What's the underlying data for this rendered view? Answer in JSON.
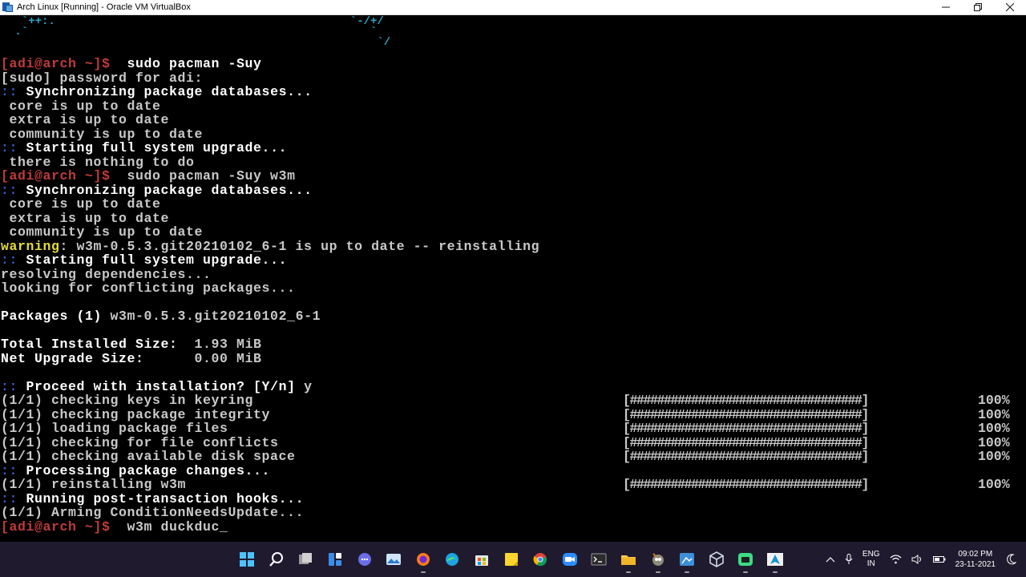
{
  "window": {
    "title": "Arch Linux [Running] - Oracle VM VirtualBox",
    "controls": {
      "minimize_icon": "minimize-icon",
      "restore_icon": "restore-icon",
      "close_icon": "close-icon"
    }
  },
  "terminal": {
    "ascii_art": {
      "left": "  `++:.\n .`",
      "right": "  `-/+/\n     `\n      `/"
    },
    "lines": [
      [
        {
          "t": "[adi@arch ~]$",
          "c": "p"
        },
        {
          "t": "  sudo pacman -Suy",
          "c": "w"
        }
      ],
      [
        {
          "t": "[sudo] password for adi:",
          "c": "g"
        }
      ],
      [
        {
          "t": "::",
          "c": "b"
        },
        {
          "t": " Synchronizing package databases...",
          "c": "w"
        }
      ],
      [
        {
          "t": " core is up to date",
          "c": "g"
        }
      ],
      [
        {
          "t": " extra is up to date",
          "c": "g"
        }
      ],
      [
        {
          "t": " community is up to date",
          "c": "g"
        }
      ],
      [
        {
          "t": "::",
          "c": "b"
        },
        {
          "t": " Starting full system upgrade...",
          "c": "w"
        }
      ],
      [
        {
          "t": " there is nothing to do",
          "c": "g"
        }
      ],
      [
        {
          "t": "[adi@arch ~]$",
          "c": "p"
        },
        {
          "t": "  sudo pacman -Suy w3m",
          "c": "g"
        }
      ],
      [
        {
          "t": "::",
          "c": "b"
        },
        {
          "t": " Synchronizing package databases...",
          "c": "w"
        }
      ],
      [
        {
          "t": " core is up to date",
          "c": "g"
        }
      ],
      [
        {
          "t": " extra is up to date",
          "c": "g"
        }
      ],
      [
        {
          "t": " community is up to date",
          "c": "g"
        }
      ],
      [
        {
          "t": "warning",
          "c": "y"
        },
        {
          "t": ": w3m-0.5.3.git20210102_6-1 is up to date -- reinstalling",
          "c": "g"
        }
      ],
      [
        {
          "t": "::",
          "c": "b"
        },
        {
          "t": " Starting full system upgrade...",
          "c": "w"
        }
      ],
      [
        {
          "t": "resolving dependencies...",
          "c": "g"
        }
      ],
      [
        {
          "t": "looking for conflicting packages...",
          "c": "g"
        }
      ],
      [
        {
          "t": "",
          "c": "g"
        }
      ],
      [
        {
          "t": "Packages (1) ",
          "c": "w"
        },
        {
          "t": "w3m-0.5.3.git20210102_6-1",
          "c": "g"
        }
      ],
      [
        {
          "t": "",
          "c": "g"
        }
      ],
      [
        {
          "t": "Total Installed Size: ",
          "c": "w"
        },
        {
          "t": " 1.93 MiB",
          "c": "g"
        }
      ],
      [
        {
          "t": "Net Upgrade Size: ",
          "c": "w"
        },
        {
          "t": "     0.00 MiB",
          "c": "g"
        }
      ],
      [
        {
          "t": "",
          "c": "g"
        }
      ],
      [
        {
          "t": "::",
          "c": "b"
        },
        {
          "t": " Proceed with installation? [Y/n]",
          "c": "w"
        },
        {
          "t": " y",
          "c": "g"
        }
      ],
      [
        {
          "t": "(1/1) checking keys in keyring",
          "c": "g"
        }
      ],
      [
        {
          "t": "(1/1) checking package integrity",
          "c": "g"
        }
      ],
      [
        {
          "t": "(1/1) loading package files",
          "c": "g"
        }
      ],
      [
        {
          "t": "(1/1) checking for file conflicts",
          "c": "g"
        }
      ],
      [
        {
          "t": "(1/1) checking available disk space",
          "c": "g"
        }
      ],
      [
        {
          "t": "::",
          "c": "b"
        },
        {
          "t": " Processing package changes...",
          "c": "w"
        }
      ],
      [
        {
          "t": "(1/1) reinstalling w3m",
          "c": "g"
        }
      ],
      [
        {
          "t": "::",
          "c": "b"
        },
        {
          "t": " Running post-transaction hooks...",
          "c": "w"
        }
      ],
      [
        {
          "t": "(1/1) Arming ConditionNeedsUpdate...",
          "c": "g"
        }
      ],
      [
        {
          "t": "[adi@arch ~]$",
          "c": "p"
        },
        {
          "t": "  w3m duckduc_",
          "c": "g"
        }
      ]
    ],
    "progress_bars": [
      {
        "line": 24,
        "bar": "[##################################]",
        "percent": "100%",
        "progress": 1.0
      },
      {
        "line": 25,
        "bar": "[##################################]",
        "percent": "100%",
        "progress": 1.0
      },
      {
        "line": 26,
        "bar": "[##################################]",
        "percent": "100%",
        "progress": 1.0
      },
      {
        "line": 27,
        "bar": "[##################################]",
        "percent": "100%",
        "progress": 1.0
      },
      {
        "line": 28,
        "bar": "[##################################]",
        "percent": "100%",
        "progress": 1.0
      },
      {
        "line": 30,
        "bar": "[##################################]",
        "percent": "100%",
        "progress": 1.0
      }
    ]
  },
  "taskbar": {
    "apps": [
      {
        "name": "start-button",
        "icon": "windows-icon"
      },
      {
        "name": "search-button",
        "icon": "search-icon"
      },
      {
        "name": "task-view-button",
        "icon": "task-view-icon"
      },
      {
        "name": "widgets-button",
        "icon": "widgets-icon"
      },
      {
        "name": "chat-button",
        "icon": "chat-icon"
      },
      {
        "name": "photos-app",
        "icon": "photos-icon"
      },
      {
        "name": "firefox-app",
        "icon": "firefox-icon",
        "running": true
      },
      {
        "name": "edge-app",
        "icon": "edge-icon"
      },
      {
        "name": "store-app",
        "icon": "store-icon"
      },
      {
        "name": "sticky-notes-app",
        "icon": "sticky-notes-icon"
      },
      {
        "name": "chrome-app",
        "icon": "chrome-icon"
      },
      {
        "name": "zoom-app",
        "icon": "zoom-icon"
      },
      {
        "name": "terminal-app",
        "icon": "terminal-icon"
      },
      {
        "name": "file-explorer-app",
        "icon": "folder-icon",
        "running": true
      },
      {
        "name": "gimp-app",
        "icon": "gimp-icon",
        "running": true
      },
      {
        "name": "paint-app",
        "icon": "paint-icon",
        "running": true
      },
      {
        "name": "virtualbox-app",
        "icon": "virtualbox-icon"
      },
      {
        "name": "android-studio-app",
        "icon": "android-icon",
        "running": true
      },
      {
        "name": "arch-vm-app",
        "icon": "arch-linux-icon",
        "running": true
      }
    ],
    "tray": {
      "language": "ENG",
      "region": "IN",
      "time": "09:02 PM",
      "date": "23-11-2021"
    }
  }
}
